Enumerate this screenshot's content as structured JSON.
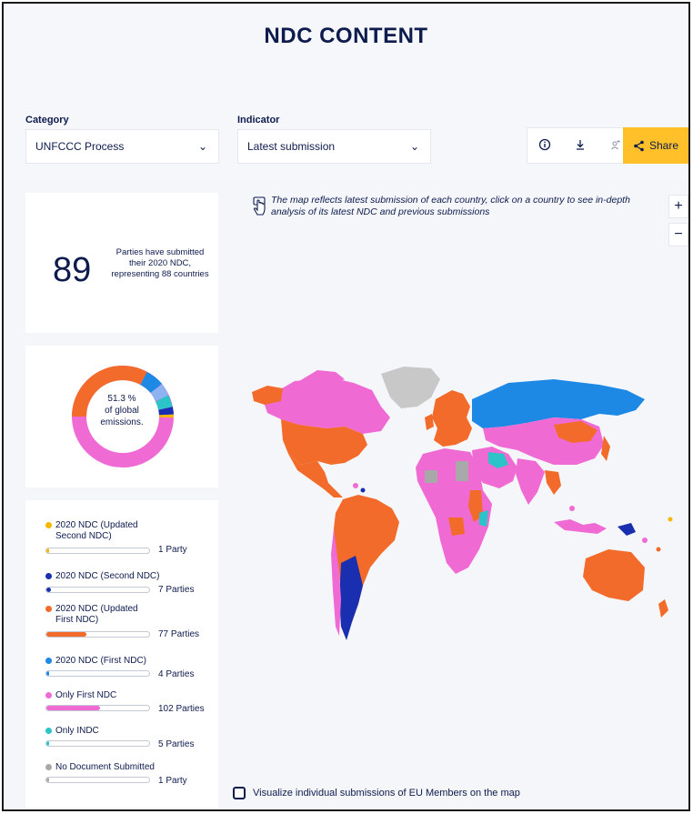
{
  "page": {
    "title": "NDC CONTENT"
  },
  "filters": {
    "category_label": "Category",
    "category_value": "UNFCCC Process",
    "indicator_label": "Indicator",
    "indicator_value": "Latest submission"
  },
  "toolbar": {
    "info_icon": "info-icon",
    "download_icon": "download-icon",
    "add_user_icon": "add-user-icon",
    "share_label": "Share"
  },
  "summary": {
    "count": "89",
    "text": "Parties have submitted their 2020 NDC, representing 88 countries"
  },
  "donut": {
    "percent": "51.3 %",
    "line2": "of global",
    "line3": "emissions."
  },
  "legend": [
    {
      "name": "2020 NDC (Updated Second NDC)",
      "count": "1 Party",
      "color": "#f5b800",
      "fraction": 0.01
    },
    {
      "name": "2020 NDC (Second NDC)",
      "count": "7 Parties",
      "color": "#1a2fb0",
      "fraction": 0.04
    },
    {
      "name": "2020 NDC (Updated First NDC)",
      "count": "77 Parties",
      "color": "#f26b2a",
      "fraction": 0.39
    },
    {
      "name": "2020 NDC (First NDC)",
      "count": "4 Parties",
      "color": "#1e88e5",
      "fraction": 0.02
    },
    {
      "name": "Only First NDC",
      "count": "102 Parties",
      "color": "#f06ad4",
      "fraction": 0.52
    },
    {
      "name": "Only INDC",
      "count": "5 Parties",
      "color": "#2cc4c9",
      "fraction": 0.03
    },
    {
      "name": "No Document Submitted",
      "count": "1 Party",
      "color": "#a8a8a8",
      "fraction": 0.01
    }
  ],
  "map": {
    "hint": "The map reflects latest submission of each country, click on a country to see in-depth analysis of its latest NDC and previous submissions",
    "zoom_in": "+",
    "zoom_out": "−"
  },
  "eu_toggle": {
    "label": "Visualize individual submissions of EU Members on the map",
    "checked": false
  }
}
